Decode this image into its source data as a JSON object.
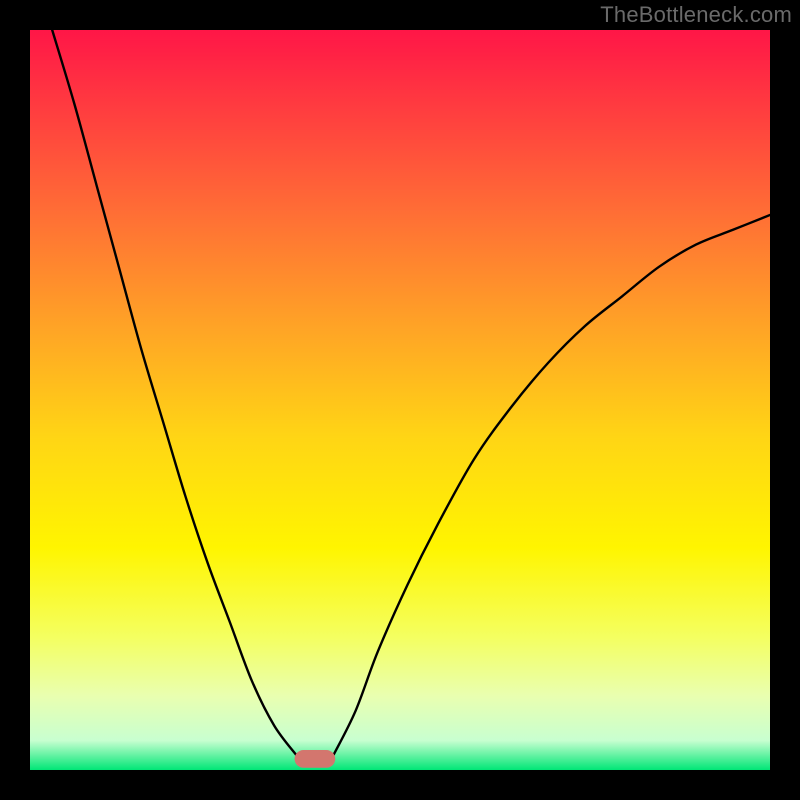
{
  "watermark": "TheBottleneck.com",
  "chart_data": {
    "type": "line",
    "title": "",
    "xlabel": "",
    "ylabel": "",
    "xlim": [
      0,
      100
    ],
    "ylim": [
      0,
      100
    ],
    "grid": false,
    "legend": null,
    "gradient_stops": [
      {
        "offset": 0.0,
        "color": "#ff1647"
      },
      {
        "offset": 0.1,
        "color": "#ff3a40"
      },
      {
        "offset": 0.25,
        "color": "#ff6f35"
      },
      {
        "offset": 0.4,
        "color": "#ffa326"
      },
      {
        "offset": 0.55,
        "color": "#ffd515"
      },
      {
        "offset": 0.7,
        "color": "#fff500"
      },
      {
        "offset": 0.82,
        "color": "#f4ff60"
      },
      {
        "offset": 0.9,
        "color": "#e9ffb0"
      },
      {
        "offset": 0.96,
        "color": "#c8ffd0"
      },
      {
        "offset": 1.0,
        "color": "#00e676"
      }
    ],
    "curves": [
      {
        "name": "left-branch",
        "x": [
          3,
          6,
          9,
          12,
          15,
          18,
          21,
          24,
          27,
          30,
          33,
          36
        ],
        "y": [
          100,
          90,
          79,
          68,
          57,
          47,
          37,
          28,
          20,
          12,
          6,
          2
        ]
      },
      {
        "name": "right-branch",
        "x": [
          41,
          44,
          47,
          51,
          55,
          60,
          65,
          70,
          75,
          80,
          85,
          90,
          95,
          100
        ],
        "y": [
          2,
          8,
          16,
          25,
          33,
          42,
          49,
          55,
          60,
          64,
          68,
          71,
          73,
          75
        ]
      }
    ],
    "marker": {
      "shape": "rounded-rect",
      "x": 38.5,
      "y": 1.5,
      "width": 5.5,
      "height": 2.4,
      "color": "#d3766e"
    }
  }
}
